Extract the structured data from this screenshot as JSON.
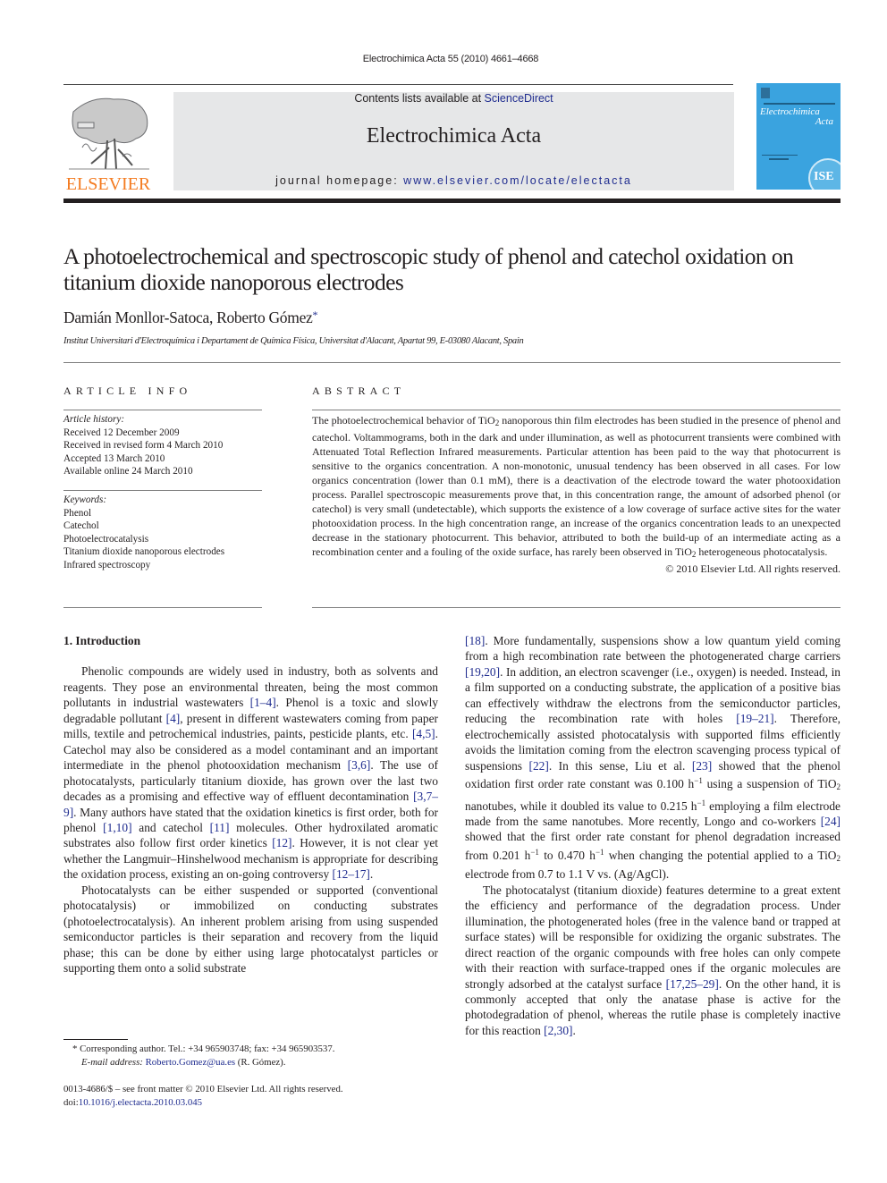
{
  "running_head": "Electrochimica Acta 55 (2010) 4661–4668",
  "masthead": {
    "publisher_logo_text": "ELSEVIER",
    "contents_prefix": "Contents lists available at ",
    "contents_link": "ScienceDirect",
    "journal_title": "Electrochimica Acta",
    "homepage_prefix": "journal homepage: ",
    "homepage_url": "www.elsevier.com/locate/electacta",
    "cover": {
      "title_line1": "Electrochimica",
      "title_line2": "Acta",
      "seal_text": "ISE",
      "color": "#3aa3df"
    },
    "brand_color": "#f47b20",
    "link_color": "#1f2c8f"
  },
  "article": {
    "title": "A photoelectrochemical and spectroscopic study of phenol and catechol oxidation on titanium dioxide nanoporous electrodes",
    "authors": "Damián Monllor-Satoca, Roberto Gómez",
    "corresponding_mark": "*",
    "affiliation": "Institut Universitari d'Electroquímica i Departament de Química Física, Universitat d'Alacant, Apartat 99, E-03080 Alacant, Spain"
  },
  "article_info": {
    "heading": "ARTICLE INFO",
    "history_label": "Article history:",
    "history": [
      "Received 12 December 2009",
      "Received in revised form 4 March 2010",
      "Accepted 13 March 2010",
      "Available online 24 March 2010"
    ],
    "keywords_label": "Keywords:",
    "keywords": [
      "Phenol",
      "Catechol",
      "Photoelectrocatalysis",
      "Titanium dioxide nanoporous electrodes",
      "Infrared spectroscopy"
    ]
  },
  "abstract": {
    "heading": "ABSTRACT",
    "p1_a": "The photoelectrochemical behavior of TiO",
    "p1_sub": "2",
    "p1_b": " nanoporous thin film electrodes has been studied in the presence of phenol and catechol. Voltammograms, both in the dark and under illumination, as well as photocurrent transients were combined with Attenuated Total Reflection Infrared measurements. Particular attention has been paid to the way that photocurrent is sensitive to the organics concentration. A non-monotonic, unusual tendency has been observed in all cases. For low organics concentration (lower than 0.1 mM), there is a deactivation of the electrode toward the water photooxidation process. Parallel spectroscopic measurements prove that, in this concentration range, the amount of adsorbed phenol (or catechol) is very small (undetectable), which supports the existence of a low coverage of surface active sites for the water photooxidation process. In the high concentration range, an increase of the organics concentration leads to an unexpected decrease in the stationary photocurrent. This behavior, attributed to both the build-up of an intermediate acting as a recombination center and a fouling of the oxide surface, has rarely been observed in TiO",
    "p1_sub2": "2",
    "p1_c": " heterogeneous photocatalysis.",
    "copyright": "© 2010 Elsevier Ltd. All rights reserved."
  },
  "intro": {
    "heading": "1.  Introduction",
    "p1": [
      {
        "t": "Phenolic compounds are widely used in industry, both as solvents and reagents. They pose an environmental threaten, being the most common pollutants in industrial wastewaters "
      },
      {
        "ref": "[1–4]"
      },
      {
        "t": ". Phenol is a toxic and slowly degradable pollutant "
      },
      {
        "ref": "[4]"
      },
      {
        "t": ", present in different wastewaters coming from paper mills, textile and petrochemical industries, paints, pesticide plants, etc. "
      },
      {
        "ref": "[4,5]"
      },
      {
        "t": ". Catechol may also be considered as a model contaminant and an important intermediate in the phenol photooxidation mechanism "
      },
      {
        "ref": "[3,6]"
      },
      {
        "t": ". The use of photocatalysts, particularly titanium dioxide, has grown over the last two decades as a promising and effective way of effluent decontamination "
      },
      {
        "ref": "[3,7–9]"
      },
      {
        "t": ". Many authors have stated that the oxidation kinetics is first order, both for phenol "
      },
      {
        "ref": "[1,10]"
      },
      {
        "t": " and catechol "
      },
      {
        "ref": "[11]"
      },
      {
        "t": " molecules. Other hydroxilated aromatic substrates also follow first order kinetics "
      },
      {
        "ref": "[12]"
      },
      {
        "t": ". However, it is not clear yet whether the Langmuir–Hinshelwood mechanism is appropriate for describing the oxidation process, existing an on-going controversy "
      },
      {
        "ref": "[12–17]"
      },
      {
        "t": "."
      }
    ],
    "p2": [
      {
        "t": "Photocatalysts can be either suspended or supported (conventional photocatalysis) or immobilized on conducting substrates (photoelectrocatalysis). An inherent problem arising from using suspended semiconductor particles is their separation and recovery from the liquid phase; this can be done by either using large photocatalyst particles or supporting them onto a solid substrate "
      },
      {
        "ref": "[18]"
      },
      {
        "t": ". More fundamentally, suspensions show a low quantum yield coming from a high recombination rate between the photogenerated charge carriers "
      },
      {
        "ref": "[19,20]"
      },
      {
        "t": ". In addition, an electron scavenger (i.e., oxygen) is needed. Instead, in a film supported on a conducting substrate, the application of a positive bias can effectively withdraw the electrons from the semiconductor particles, reducing the recombination rate with holes "
      },
      {
        "ref": "[19–21]"
      },
      {
        "t": ". Therefore, electrochemically assisted photocatalysis with supported films efficiently avoids the limitation coming from the electron scavenging process typical of suspensions "
      },
      {
        "ref": "[22]"
      },
      {
        "t": ". In this sense, Liu et al. "
      },
      {
        "ref": "[23]"
      },
      {
        "t": " showed that the phenol oxidation first order rate constant was 0.100 h"
      },
      {
        "sup": "−1"
      },
      {
        "t": " using a suspension of TiO"
      },
      {
        "sub": "2"
      },
      {
        "t": " nanotubes, while it doubled its value to 0.215 h"
      },
      {
        "sup": "−1"
      },
      {
        "t": " employing a film electrode made from the same nanotubes. More recently, Longo and co-workers "
      },
      {
        "ref": "[24]"
      },
      {
        "t": " showed that the first order rate constant for phenol degradation increased from 0.201 h"
      },
      {
        "sup": "−1"
      },
      {
        "t": " to 0.470 h"
      },
      {
        "sup": "−1"
      },
      {
        "t": " when changing the potential applied to a TiO"
      },
      {
        "sub": "2"
      },
      {
        "t": " electrode from 0.7 to 1.1 V vs. (Ag/AgCl)."
      }
    ],
    "p3": [
      {
        "t": "The photocatalyst (titanium dioxide) features determine to a great extent the efficiency and performance of the degradation process. Under illumination, the photogenerated holes (free in the valence band or trapped at surface states) will be responsible for oxidizing the organic substrates. The direct reaction of the organic compounds with free holes can only compete with their reaction with surface-trapped ones if the organic molecules are strongly adsorbed at the catalyst surface "
      },
      {
        "ref": "[17,25–29]"
      },
      {
        "t": ". On the other hand, it is commonly accepted that only the anatase phase is active for the photodegradation of phenol, whereas the rutile phase is completely inactive for this reaction "
      },
      {
        "ref": "[2,30]"
      },
      {
        "t": "."
      }
    ]
  },
  "footnotes": {
    "corresponding": "* Corresponding author. Tel.: +34 965903748; fax: +34 965903537.",
    "email_label": "E-mail address:",
    "email": "Roberto.Gomez@ua.es",
    "email_suffix": " (R. Gómez).",
    "front_matter": "0013-4686/$ – see front matter © 2010 Elsevier Ltd. All rights reserved.",
    "doi_prefix": "doi:",
    "doi": "10.1016/j.electacta.2010.03.045"
  }
}
